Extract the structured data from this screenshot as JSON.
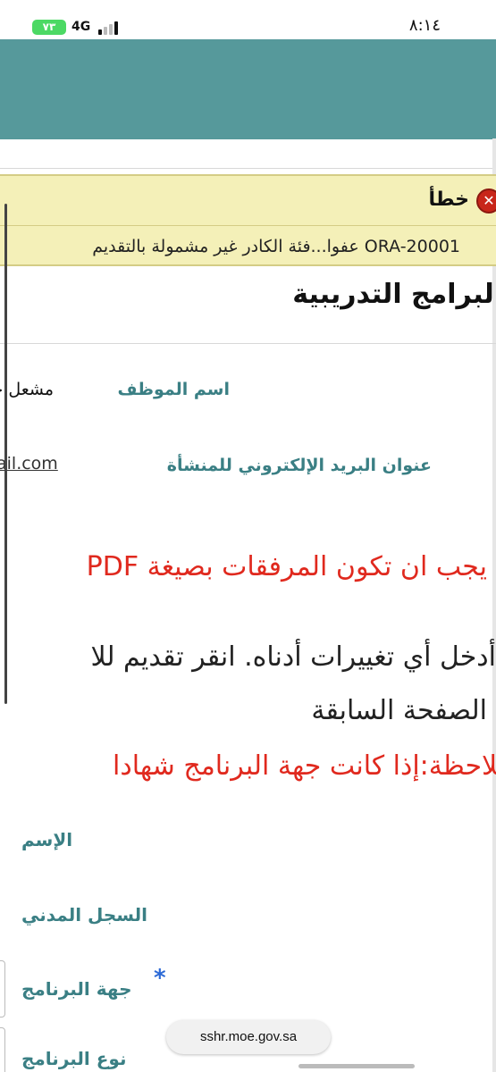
{
  "status_bar": {
    "time": "٨:١٤",
    "network": "4G",
    "battery": "٧٣"
  },
  "error": {
    "title": "خطأ",
    "message": "ORA-20001 عفوا...فئة الكادر غير مشمولة بالتقديم"
  },
  "page": {
    "title": "البرامج التدريبية"
  },
  "employee": {
    "name_label": "اسم الموظف",
    "name_value": "مشعل حـ",
    "email_label": "عنوان البريد الإلكتروني للمنشأة",
    "email_value": "ail.com"
  },
  "notes": {
    "pdf_note": "يجب ان تكون المرفقات بصيغة PDF",
    "instruction_line1": "أدخل أي تغييرات أدناه. انقر تقديم للا",
    "instruction_line2": "الصفحة السابقة",
    "remark": "ملاحظة:إذا كانت جهة البرنامج شهادا"
  },
  "form": {
    "name_label": "الإسم",
    "civil_record_label": "السجل المدني",
    "program_entity_label": "جهة البرنامج",
    "program_type_label": "نوع البرنامج",
    "required_mark": "*"
  },
  "browser": {
    "url": "sshr.moe.gov.sa"
  },
  "colors": {
    "header": "#56999b",
    "error_bg": "#f4f0b8",
    "label": "#3a7f84",
    "warning": "#e0291e",
    "required": "#2d6ad6"
  }
}
